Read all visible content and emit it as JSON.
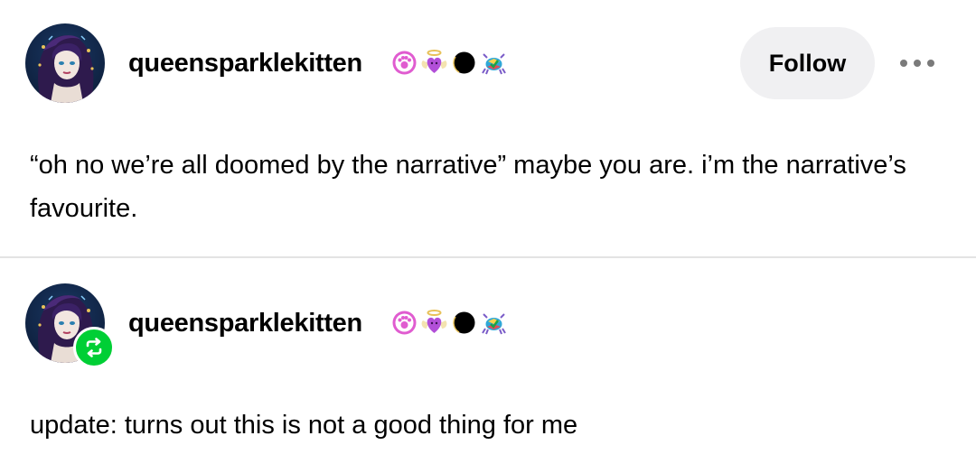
{
  "posts": [
    {
      "username": "queensparklekitten",
      "badges": [
        "paw-badge-icon",
        "heart-angel-badge-icon",
        "eclipse-badge-icon",
        "crab-badge-icon"
      ],
      "follow_label": "Follow",
      "more_icon": "ellipsis-icon",
      "body": "“oh no we’re all doomed by the narrative” maybe you are. i’m the narrative’s favourite."
    },
    {
      "username": "queensparklekitten",
      "badges": [
        "paw-badge-icon",
        "heart-angel-badge-icon",
        "eclipse-badge-icon",
        "crab-badge-icon"
      ],
      "reblog_icon": "reblog-icon",
      "body": "update: turns out this is not a good thing for me"
    }
  ],
  "colors": {
    "follow_bg": "#f0f0f2",
    "reblog_green": "#00cf35",
    "divider": "#e3e3e3",
    "more_dots": "#7a7a7a"
  }
}
